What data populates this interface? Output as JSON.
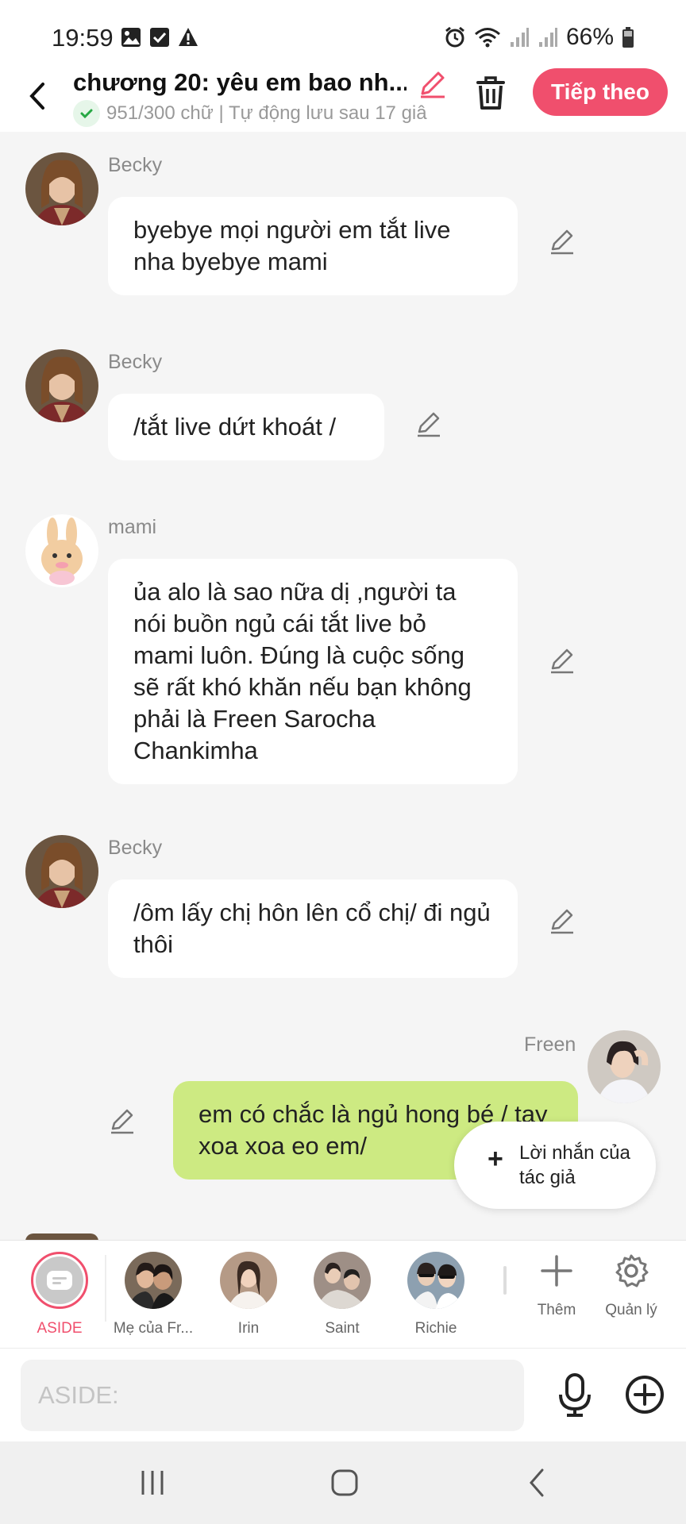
{
  "status_bar": {
    "time": "19:59",
    "left_icons": [
      "image-icon",
      "checkbox-icon",
      "warning-icon"
    ],
    "right_icons": [
      "alarm-icon",
      "wifi-icon",
      "signal-icon",
      "signal-icon",
      "battery-icon"
    ],
    "battery": "66%"
  },
  "header": {
    "title": "chương 20: yêu em bao nh...",
    "subtitle": "951/300 chữ | Tự động lưu sau 17 giâ",
    "next_label": "Tiếp theo",
    "accent_color": "#f04f6d"
  },
  "messages": [
    {
      "sender": "Becky",
      "text": "byebye mọi người em tắt live nha byebye mami",
      "side": "left"
    },
    {
      "sender": "Becky",
      "text": "/tắt live dứt khoát /",
      "side": "left"
    },
    {
      "sender": "mami",
      "text": "ủa alo là sao nữa dị ,người ta nói buồn ngủ cái tắt live bỏ mami luôn. Đúng là cuộc sống sẽ rất khó khăn nếu bạn không phải là Freen Sarocha Chankimha",
      "side": "left"
    },
    {
      "sender": "Becky",
      "text": "/ôm lấy chị hôn lên cổ chị/ đi ngủ thôi",
      "side": "left"
    },
    {
      "sender": "Freen",
      "text": "em có chắc là ngủ hong bé / tay xoa xoa eo em/",
      "side": "right"
    }
  ],
  "author_note": {
    "label": "Lời nhắn của tác giả"
  },
  "characters": [
    {
      "name": "ASIDE",
      "active": true
    },
    {
      "name": "Mẹ của Fr..."
    },
    {
      "name": "Irin"
    },
    {
      "name": "Saint"
    },
    {
      "name": "Richie"
    }
  ],
  "tools": {
    "add_label": "Thêm",
    "manage_label": "Quản lý"
  },
  "input": {
    "placeholder": "ASIDE:"
  }
}
